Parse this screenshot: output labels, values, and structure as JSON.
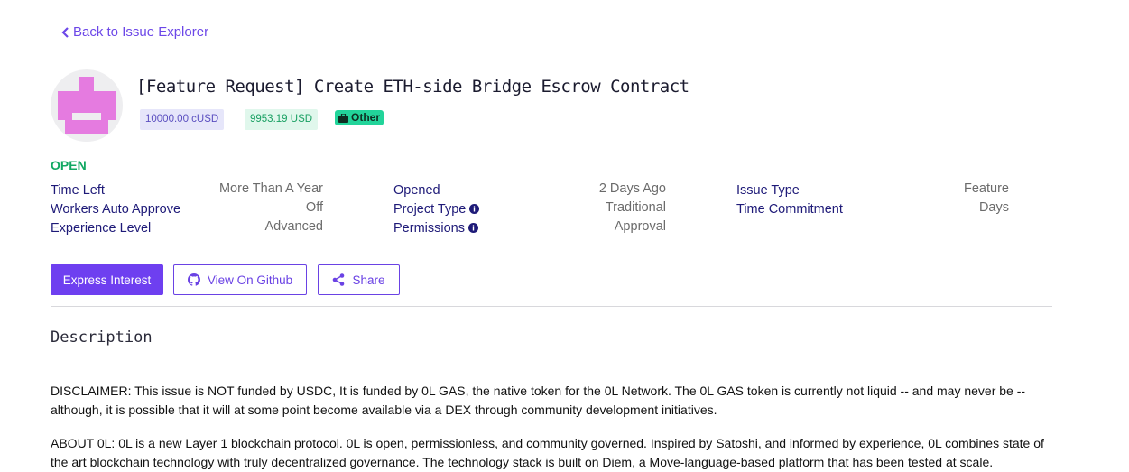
{
  "nav": {
    "back_label": "Back to Issue Explorer"
  },
  "issue": {
    "title": "[Feature Request] Create ETH-side Bridge Escrow Contract",
    "badges": {
      "reward_cusd": "10000.00 cUSD",
      "reward_usd": "9953.19 USD",
      "category": "Other"
    },
    "status": "OPEN"
  },
  "meta": {
    "col1": [
      {
        "label": "Time Left",
        "value": "More Than A Year"
      },
      {
        "label": "Workers Auto Approve",
        "value": "Off"
      },
      {
        "label": "Experience Level",
        "value": "Advanced"
      }
    ],
    "col2": [
      {
        "label": "Opened",
        "value": "2 Days Ago"
      },
      {
        "label": "Project Type",
        "value": "Traditional"
      },
      {
        "label": "Permissions",
        "value": "Approval"
      }
    ],
    "col3": [
      {
        "label": "Issue Type",
        "value": "Feature"
      },
      {
        "label": "Time Commitment",
        "value": "Days"
      }
    ]
  },
  "actions": {
    "express_interest": "Express Interest",
    "view_github": "View On Github",
    "share": "Share"
  },
  "description": {
    "heading": "Description",
    "p1": "DISCLAIMER: This issue is NOT funded by USDC, It is funded by 0L GAS, the native token for the 0L Network. The 0L GAS token is currently not liquid -- and may never be -- although, it is possible that it will at some point become available via a DEX through community development initiatives.",
    "p2": "ABOUT 0L: 0L is a new Layer 1 blockchain protocol. 0L is open, permissionless, and community governed. Inspired by Satoshi, and informed by experience, 0L combines state of the art blockchain technology with truly decentralized governance. The technology stack is built on Diem, a Move-language-based platform that has been tested at scale."
  },
  "colors": {
    "accent": "#6e3ff0",
    "status_open": "#11a862",
    "label": "#1e1a78",
    "other_badge": "#22d49a"
  }
}
